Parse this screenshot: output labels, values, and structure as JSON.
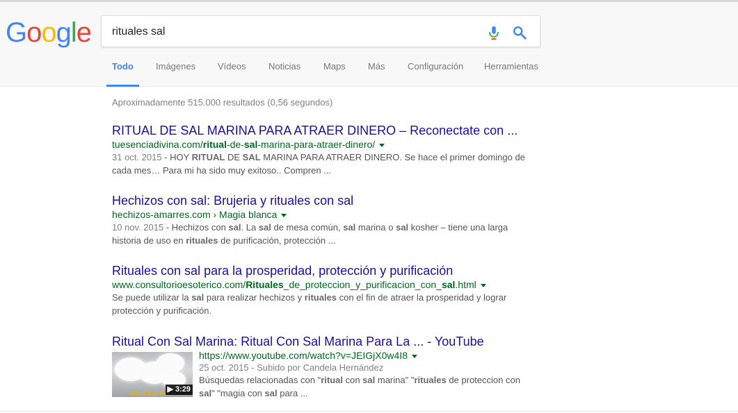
{
  "logo": {
    "letters": [
      "G",
      "o",
      "o",
      "g",
      "l",
      "e"
    ]
  },
  "search": {
    "query": "rituales sal",
    "mic_icon": "mic-icon",
    "search_icon": "search-icon"
  },
  "tabs": [
    {
      "label": "Todo",
      "active": true
    },
    {
      "label": "Imágenes"
    },
    {
      "label": "Vídeos"
    },
    {
      "label": "Noticias"
    },
    {
      "label": "Maps"
    },
    {
      "label": "Más"
    },
    {
      "label": "Configuración"
    },
    {
      "label": "Herramientas"
    }
  ],
  "stats": "Aproximadamente 515.000 resultados (0,56 segundos)",
  "results": [
    {
      "title": "RITUAL DE SAL MARINA PARA ATRAER DINERO – Reconectate con ...",
      "url_parts": [
        "tuesenciadivina.com/",
        "ritual",
        "-de-",
        "sal",
        "-marina-para-atraer-dinero/"
      ],
      "date": "31 oct. 2015",
      "snippet_parts": [
        " - HOY ",
        "RITUAL",
        " DE ",
        "SAL",
        " MARINA PARA ATRAER DINERO. Se hace el primer domingo de cada mes… Para mi ha sido muy exitoso.. Compren ..."
      ]
    },
    {
      "title": "Hechizos con sal: Brujeria y rituales con sal",
      "url_parts": [
        "hechizos-amarres.com › Magia blanca"
      ],
      "date": "10 nov. 2015",
      "snippet_parts": [
        " - Hechizos con ",
        "sal",
        ". La ",
        "sal",
        " de mesa común, ",
        "sal",
        " marina o ",
        "sal",
        " kosher – tiene una larga historia de uso en ",
        "rituales",
        " de purificación, protección ..."
      ]
    },
    {
      "title": "Rituales con sal para la prosperidad, protección y purificación",
      "url_parts": [
        "www.consultorioesoterico.com/",
        "Rituales",
        "_de_proteccion_y_purificacion_con_",
        "sal",
        ".html"
      ],
      "snippet_parts": [
        "Se puede utilizar la ",
        "sal",
        " para realizar hechizos y ",
        "rituales",
        " con el fin de atraer la prosperidad y lograr protección y purificación."
      ]
    },
    {
      "title": "Ritual Con Sal Marina: Ritual Con Sal Marina Para La ... - YouTube",
      "url": "https://www.youtube.com/watch?v=JEIGjX0w4I8",
      "meta": "25 oct. 2015 - Subido por Candela Hernández",
      "snippet_parts": [
        "Búsquedas relacionadas con \"",
        "ritual",
        " con ",
        "sal",
        " marina\" \"",
        "rituales",
        " de proteccion con ",
        "sal",
        "\" \"magia con ",
        "sal",
        " para ..."
      ],
      "thumb_label": "Ritual Con Sal",
      "duration": "3:29"
    }
  ],
  "colors": {
    "link": "#1a0dab",
    "url": "#006621",
    "accent": "#4285f4",
    "snippet": "#545454"
  }
}
